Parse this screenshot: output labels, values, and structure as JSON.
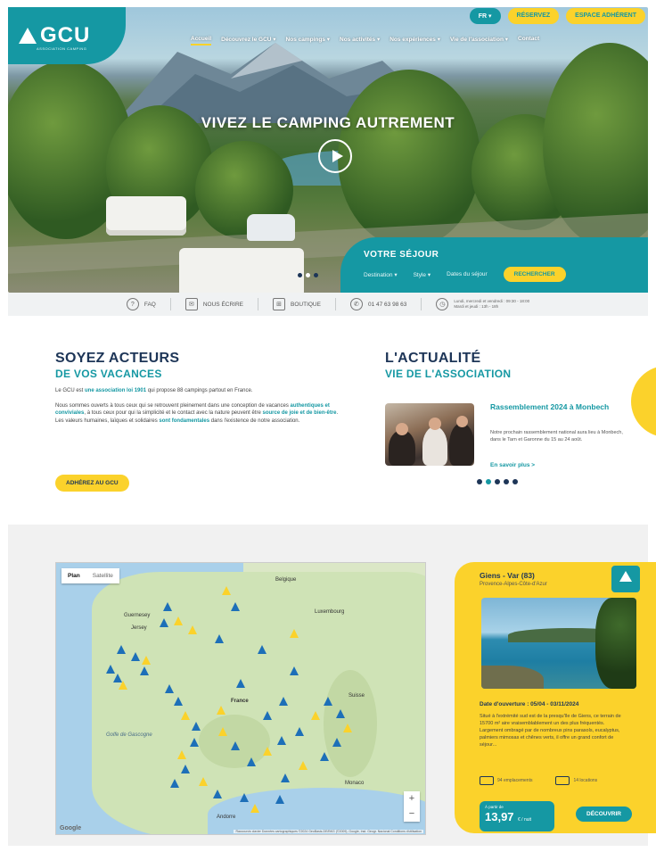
{
  "header": {
    "logo_text": "GCU",
    "logo_sub": "ASSOCIATION CAMPING",
    "lang_label": "FR ▾",
    "reserve_label": "RÉSERVEZ",
    "member_label": "ESPACE ADHÉRENT",
    "nav": [
      "Accueil",
      "Découvrez le GCU ▾",
      "Nos campings ▾",
      "Nos activités ▾",
      "Nos expériences ▾",
      "Vie de l'association ▾",
      "Contact"
    ]
  },
  "hero": {
    "title": "VIVEZ LE CAMPING AUTREMENT",
    "sejour_title": "VOTRE SÉJOUR",
    "destination": "Destination ▾",
    "style": "Style ▾",
    "dates": "Dates du séjour",
    "search_label": "RECHERCHER",
    "slide_active": 2,
    "slide_count": 3
  },
  "infobar": {
    "faq": "FAQ",
    "write": "NOUS ÉCRIRE",
    "shop": "BOUTIQUE",
    "phone": "01 47 63 98 63",
    "hours_1": "Lundi, mercredi et vendredi : 09:30 - 18:00",
    "hours_2": "Mardi et jeudi : 13h - 18h"
  },
  "acteurs": {
    "title": "SOYEZ ACTEURS",
    "subtitle": "DE VOS VACANCES",
    "p1_a": "Le GCU est ",
    "p1_b": "une association loi 1901",
    "p1_c": " qui propose 88 campings partout en France.",
    "p2_a": "Nous sommes ouverts à tous ceux qui se retrouvent pleinement dans une conception de vacances ",
    "p2_b": "authentiques et conviviales",
    "p2_c": ", à tous ceux pour qui la simplicité et le contact avec la nature peuvent être ",
    "p2_d": "source de joie et de bien-être",
    "p2_e": ". Les valeurs humaines, laïques et solidaires ",
    "p2_f": "sont fondamentales",
    "p2_g": " dans l'existence de notre association.",
    "button": "ADHÉREZ AU GCU"
  },
  "actualite": {
    "title": "L'ACTUALITÉ",
    "subtitle": "VIE DE L'ASSOCIATION",
    "card_title": "Rassemblement 2024 à Monbech",
    "card_text": "Notre prochain rassemblement national aura lieu à Monbech, dans le Tarn et Garonne du 15 au 24 août.",
    "more": "En savoir plus >",
    "slide_active": 1,
    "slide_count": 5
  },
  "map": {
    "plan": "Plan",
    "satellite": "Satellite",
    "labels": [
      "Belgique",
      "Luxembourg",
      "Guernesey",
      "Jersey",
      "France",
      "Suisse",
      "Monaco",
      "Andorre",
      "Golfe de Gascogne"
    ],
    "zoom_in": "+",
    "zoom_out": "−",
    "google": "Google",
    "footer": "Raccourcis clavier  Données cartographiques ©2024 GeoBasis-DE/BKG (©2009), Google, Inst. Geogr. Nacional  Conditions d'utilisation"
  },
  "camping": {
    "name": "Giens - Var (83)",
    "region": "Provence-Alpes-Côte-d'Azur",
    "date": "Date d'ouverture : 05/04 - 03/11/2024",
    "desc": "Situé à l'extrémité sud est de la presqu'île de Giens, ce terrain de 15700 m² aire vraisemblablement un des plus fréquentés. Largement ombragé par de nombreux pins parasols, eucalyptus, palmiers mimosas et chênes verts, il offre un grand confort de séjour...",
    "emplacements": "94 emplacements",
    "locations": "14 locations",
    "from": "À partir de",
    "price": "13,97",
    "per": "€ / nuit",
    "button": "DÉCOUVRIR"
  },
  "colors": {
    "teal": "#1598a3",
    "yellow": "#fbd22b",
    "navy": "#1d3557"
  }
}
